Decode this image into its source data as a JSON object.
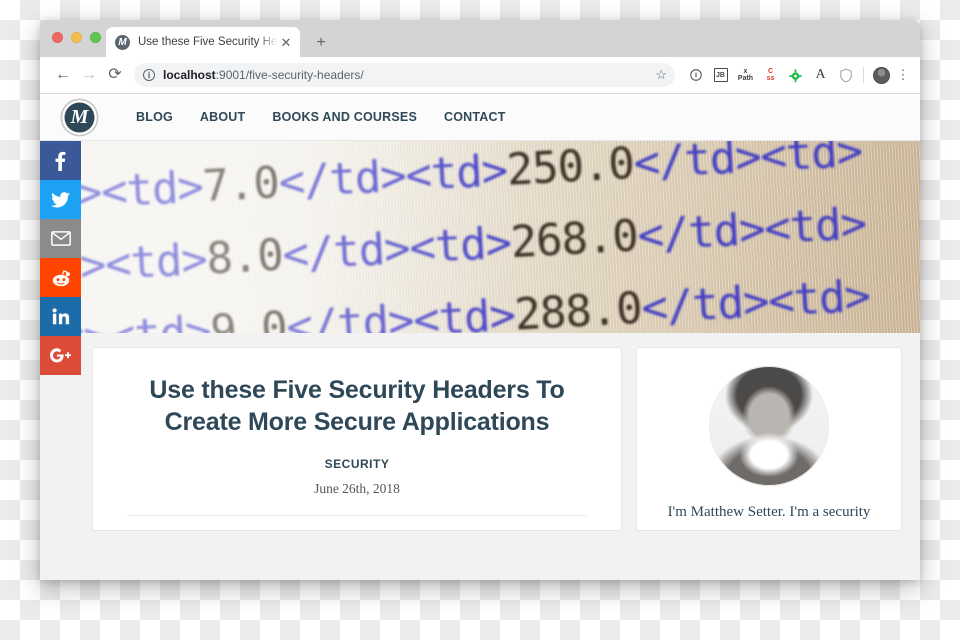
{
  "browser": {
    "tab": {
      "title": "Use these Five Security Heade",
      "favicon_label": "M",
      "close_label": "✕"
    },
    "new_tab_label": "+",
    "nav": {
      "back": "←",
      "forward": "→",
      "reload": "⟳"
    },
    "omnibox": {
      "info_icon_label": "i",
      "url_host": "localhost",
      "url_path": ":9001/five-security-headers/",
      "star_label": "☆"
    },
    "extensions": [
      {
        "name": "info-circle",
        "label": "ⓘ"
      },
      {
        "name": "jetbrains",
        "label": "JB"
      },
      {
        "name": "xpath",
        "label": "XPath"
      },
      {
        "name": "css-selector",
        "label": "CSS"
      },
      {
        "name": "bug",
        "label": "⚙"
      },
      {
        "name": "font",
        "label": "A"
      },
      {
        "name": "shield",
        "label": "⛨"
      }
    ],
    "menu_label": "⋮"
  },
  "site": {
    "logo_label": "M",
    "nav_links": [
      {
        "label": "BLOG"
      },
      {
        "label": "ABOUT"
      },
      {
        "label": "BOOKS AND COURSES"
      },
      {
        "label": "CONTACT"
      }
    ]
  },
  "social": [
    {
      "name": "facebook",
      "label": "f",
      "color": "#3b5998"
    },
    {
      "name": "twitter",
      "label": "t",
      "color": "#1da1f2"
    },
    {
      "name": "email",
      "label": "@",
      "color": "#8b8b8b"
    },
    {
      "name": "reddit",
      "label": "r",
      "color": "#ff4500"
    },
    {
      "name": "linkedin",
      "label": "in",
      "color": "#1b6ca8"
    },
    {
      "name": "googleplus",
      "label": "G+",
      "color": "#dd4b39"
    }
  ],
  "hero": {
    "rows": [
      {
        "pre": "<tr><td>",
        "num": "7.0",
        "mid": "</td><td>",
        "num2": "250.0",
        "post": "</td><td>"
      },
      {
        "pre": "<tr><td>",
        "num": "8.0",
        "mid": "</td><td>",
        "num2": "268.0",
        "post": "</td><td>"
      },
      {
        "pre": "<tr><td>",
        "num": "9.0",
        "mid": "</td><td>",
        "num2": "288.0",
        "post": "</td><td>"
      }
    ]
  },
  "article": {
    "title": "Use these Five Security Headers To Create More Secure Applications",
    "category": "SECURITY",
    "date": "June 26th, 2018"
  },
  "aside": {
    "bio": "I'm Matthew Setter. I'm a security"
  }
}
